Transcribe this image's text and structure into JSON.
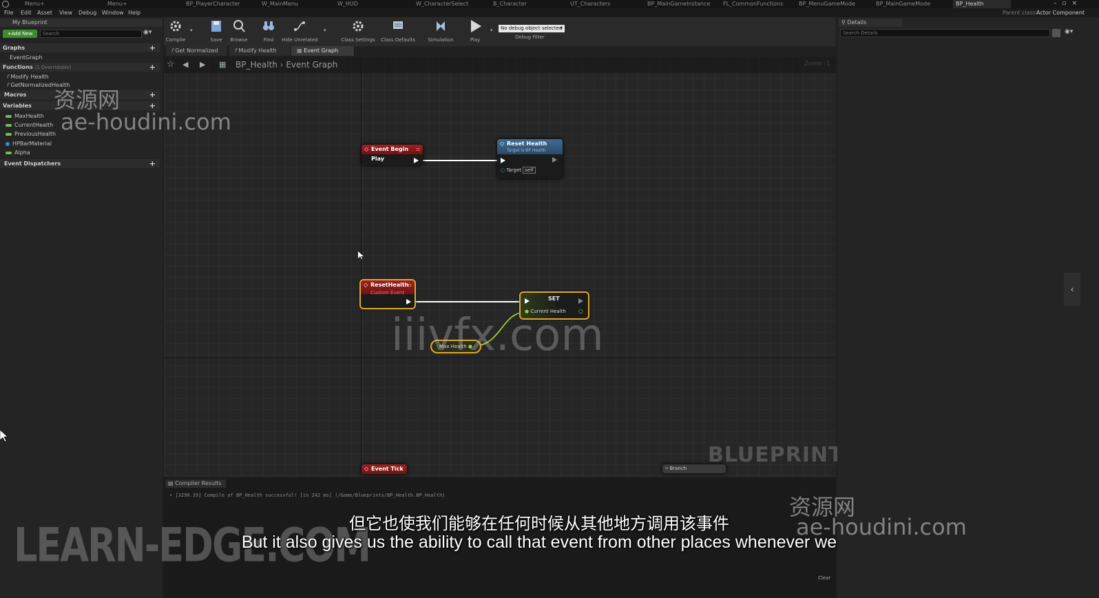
{
  "top_tabs": [
    "Menu+",
    "Menu+",
    "BP_PlayerCharacter",
    "W_MainMenu",
    "W_HUD",
    "W_CharacterSelect",
    "B_Character",
    "UT_Characters",
    "BP_MainGameInstance",
    "FL_CommonFunctions",
    "BP_MenuGameMode",
    "BP_MainGameMode",
    "BP_Health"
  ],
  "parent_class": {
    "label": "Parent class:",
    "value": "Actor Component"
  },
  "menus": [
    "File",
    "Edit",
    "Asset",
    "View",
    "Debug",
    "Window",
    "Help"
  ],
  "left_panel": {
    "title": "My Blueprint",
    "add_new": "+Add New",
    "search_placeholder": "Search",
    "sections": {
      "graphs": "Graphs",
      "event_graph": "EventGraph",
      "functions": "Functions",
      "functions_count": "(1 Overridable)",
      "macros": "Macros",
      "variables": "Variables",
      "event_dispatchers": "Event Dispatchers"
    },
    "functions": [
      "Modify Health",
      "GetNormalizedHealth"
    ],
    "variables": [
      {
        "name": "MaxHealth",
        "color": "#6ec24c"
      },
      {
        "name": "CurrentHealth",
        "color": "#6ec24c"
      },
      {
        "name": "PreviousHealth",
        "color": "#6ec24c"
      },
      {
        "name": "HPBarMaterial",
        "color": "#2a8fd6"
      },
      {
        "name": "Alpha",
        "color": "#6ec24c"
      }
    ]
  },
  "toolbar": {
    "compile": "Compile",
    "save": "Save",
    "browse": "Browse",
    "find": "Find",
    "hide_unrelated": "Hide Unrelated",
    "class_settings": "Class Settings",
    "class_defaults": "Class Defaults",
    "simulation": "Simulation",
    "play": "Play",
    "debug_select": "No debug object selected",
    "debug_filter": "Debug Filter"
  },
  "doc_tabs": [
    "Get Normalized He",
    "Modify Health",
    "Event Graph"
  ],
  "breadcrumb": {
    "root": "BP_Health",
    "current": "Event Graph",
    "zoom": "Zoom -1"
  },
  "nodes": {
    "event_begin_play": "Event Begin Play",
    "reset_health_call": {
      "title": "Reset Health",
      "subtitle": "Target is BP Health",
      "target_label": "Target",
      "target_value": "self"
    },
    "reset_health_event": {
      "title": "ResetHealth",
      "subtitle": "Custom Event"
    },
    "set_node": {
      "title": "SET",
      "pin": "Current Health"
    },
    "max_health_getter": "Max Health",
    "event_tick": "Event Tick",
    "branch": "Branch"
  },
  "graph_watermark": "BLUEPRINT",
  "right_panel": {
    "title": "Details",
    "search_placeholder": "Search Details"
  },
  "compiler": {
    "tab": "Compiler Results",
    "log": "[3290.39] Compile of BP_Health successful! [in 242 ms] (/Game/Blueprints/BP_Health.BP_Health)",
    "clear": "Clear"
  },
  "subtitles": {
    "zh": "但它也使我们能够在任何时候从其他地方调用该事件",
    "en": "But it also gives us the ability to call that event from other places whenever we"
  },
  "watermarks": {
    "cn1": "资源网",
    "site1": "ae-houdini.com",
    "center": "iiivfx.com",
    "learn": "LEARN-EDGE.COM",
    "cn2": "资源网",
    "site2": "ae-houdini.com"
  },
  "colors": {
    "exec_red": "#a12020",
    "call_blue": "#3f6c94",
    "var_green": "#6ec24c",
    "select_gold": "#e0a82a"
  }
}
